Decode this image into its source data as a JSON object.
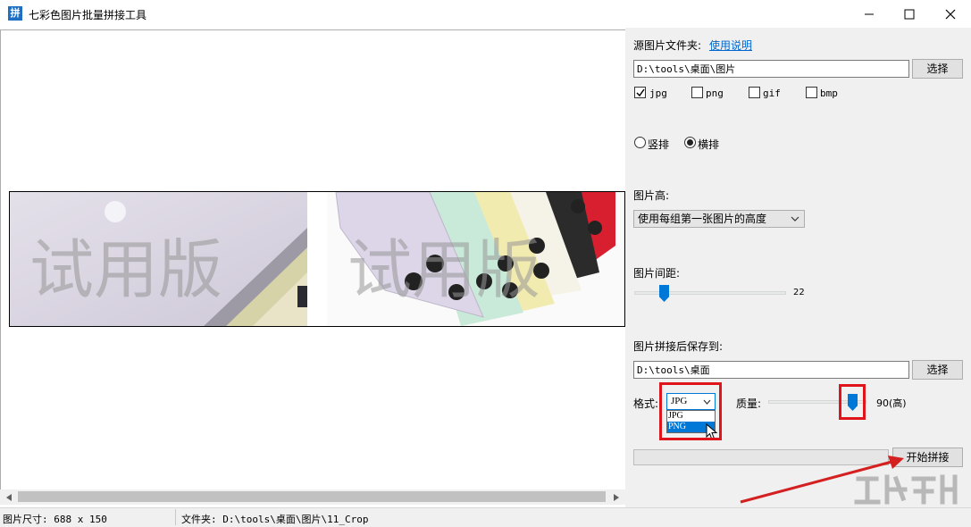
{
  "window": {
    "icon_glyph": "拼",
    "title": "七彩色图片批量拼接工具",
    "minimize_icon": "minimize-icon",
    "maximize_icon": "maximize-icon",
    "close_icon": "close-icon"
  },
  "preview": {
    "watermark_left": "试用版",
    "watermark_right": "试用版"
  },
  "panel": {
    "source_label": "源图片文件夹:",
    "help_link": "使用说明",
    "source_path": "D:\\tools\\桌面\\图片",
    "browse_source": "选择",
    "types": [
      {
        "label": "jpg",
        "checked": true
      },
      {
        "label": "png",
        "checked": false
      },
      {
        "label": "gif",
        "checked": false
      },
      {
        "label": "bmp",
        "checked": false
      }
    ],
    "orientation": [
      {
        "label": "竖排",
        "selected": false
      },
      {
        "label": "横排",
        "selected": true
      }
    ],
    "height_label": "图片高:",
    "height_option": "使用每组第一张图片的高度",
    "spacing_label": "图片间距:",
    "spacing_value": "22",
    "save_label": "图片拼接后保存到:",
    "save_path": "D:\\tools\\桌面",
    "browse_save": "选择",
    "format_label": "格式:",
    "format_selected": "JPG",
    "format_options": [
      "JPG",
      "PNG"
    ],
    "quality_label": "质量:",
    "quality_value": "90(高)",
    "start_button": "开始拼接",
    "progress": 0
  },
  "status": {
    "size": "图片尺寸: 688 x 150",
    "folder": "文件夹: D:\\tools\\桌面\\图片\\11_Crop"
  },
  "colors": {
    "accent": "#0078d7",
    "highlight_box": "#e0141b",
    "arrow": "#d42020"
  }
}
